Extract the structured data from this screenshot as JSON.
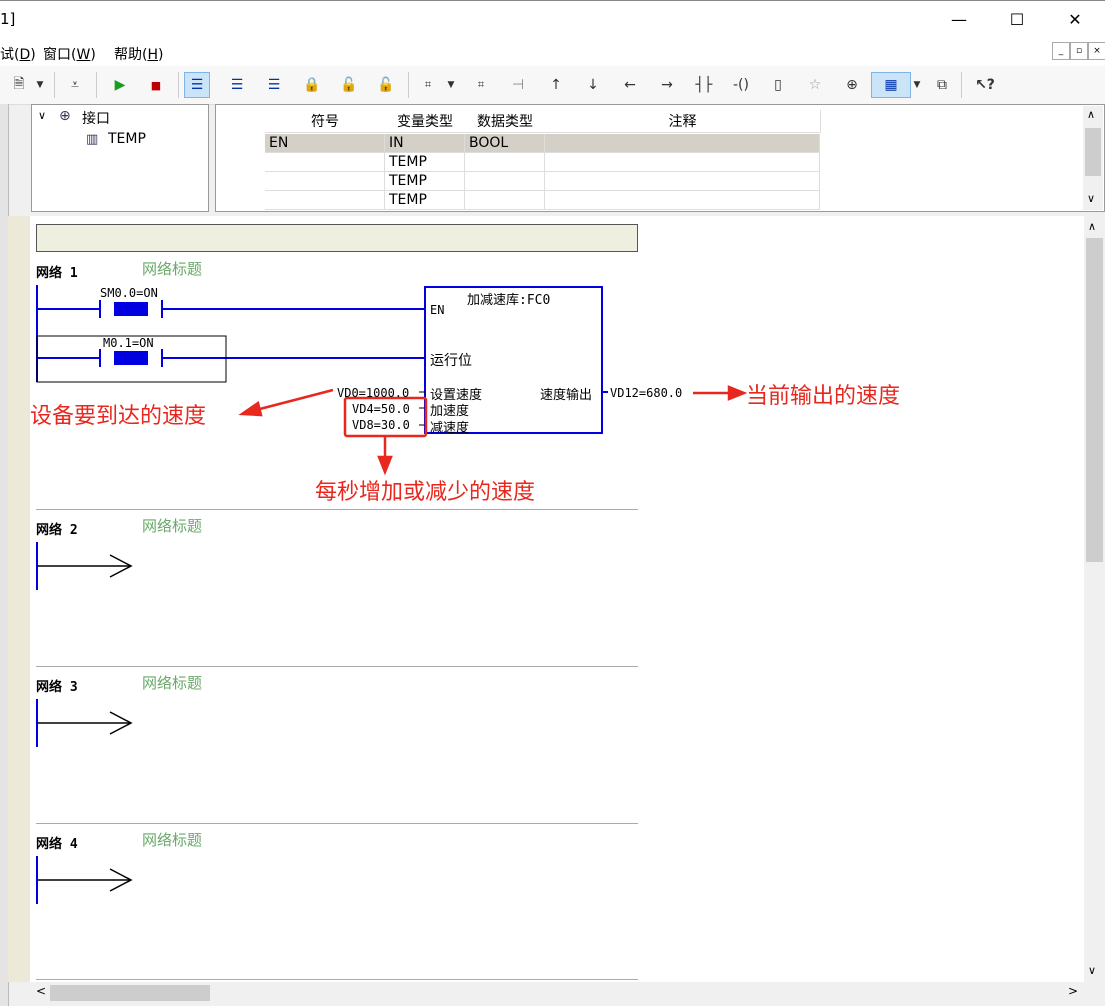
{
  "window": {
    "title_fragment": "1]",
    "minimize": "—",
    "maximize": "☐",
    "close": "✕"
  },
  "menu": [
    {
      "label": "试(D)",
      "display": "试(",
      "key": "D",
      "tail": ")"
    },
    {
      "label": "窗口(W)",
      "display": "窗口(",
      "key": "W",
      "tail": ")"
    },
    {
      "label": "帮助(H)",
      "display": "帮助(",
      "key": "H",
      "tail": ")"
    }
  ],
  "tree": {
    "root": "接口",
    "child": "TEMP"
  },
  "var_table": {
    "headers": [
      "符号",
      "变量类型",
      "数据类型",
      "注释"
    ],
    "rows": [
      [
        "EN",
        "IN",
        "BOOL",
        ""
      ],
      [
        "",
        "TEMP",
        "",
        ""
      ],
      [
        "",
        "TEMP",
        "",
        ""
      ],
      [
        "",
        "TEMP",
        "",
        ""
      ]
    ]
  },
  "networks": [
    {
      "label": "网络  1",
      "comment": "网络标题"
    },
    {
      "label": "网络  2",
      "comment": "网络标题"
    },
    {
      "label": "网络  3",
      "comment": "网络标题"
    },
    {
      "label": "网络  4",
      "comment": "网络标题"
    }
  ],
  "ladder": {
    "contact1": "SM0.0=ON",
    "contact2": "M0.1=ON",
    "block_title": "加减速库:FC0",
    "pin_en": "EN",
    "pin_run": "运行位",
    "pin_set": "设置速度",
    "pin_acc": "加速度",
    "pin_dec": "减速度",
    "pin_out": "速度输出",
    "val_set": "VD0=1000.0",
    "val_acc": "VD4=50.0",
    "val_dec": "VD8=30.0",
    "val_out": "VD12=680.0"
  },
  "annotations": {
    "target_speed": "设备要到达的速度",
    "output_speed": "当前输出的速度",
    "per_second": "每秒增加或减少的速度"
  },
  "colors": {
    "ladder_blue": "#0000e0",
    "annot_red": "#e8281e",
    "comment_green": "#6aa96a"
  }
}
